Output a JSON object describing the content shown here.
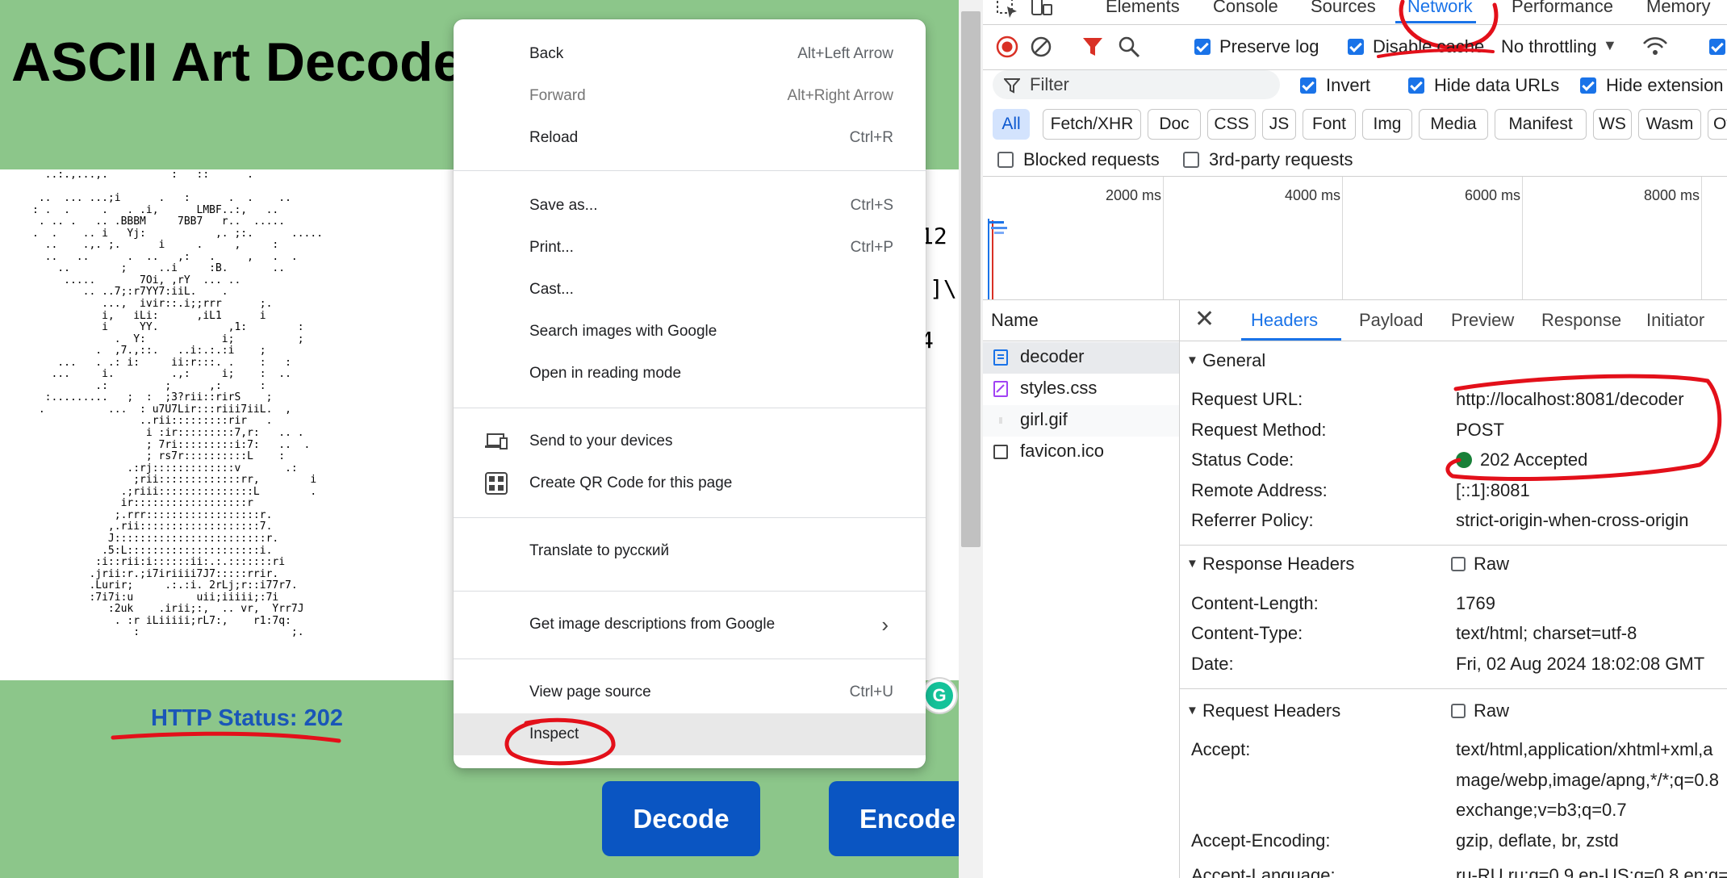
{
  "page": {
    "title": "ASCII Art Decoder",
    "http_status": "HTTP Status: 202",
    "side_fragments": [
      "12",
      "]\\",
      "4"
    ],
    "decode_label": "Decode",
    "encode_label": "Encode",
    "grammarly": "G",
    "ascii_art": "  ..:.,...,.          :   ::      .\n\n ..  ... ...;i      .   :      .  .    ..\n: .  .     .   . .i,      LMBF..:,   ..\n . .. .   .. .BBBM     7BB7   r..  .....\n.  .    .. i   Yj:           ,. ;:.      .....\n  ..    .,. ;.      i     .     ,     :\n  ..   ..      .  ..   ,:   .     ,   .  .\n    ..        ;     ..i     :B.       ..\n     .....       7Oi, ,rY  ... ..\n        .. ..7;:r7YY7:iiL.    .\n           ...,  ivir::.i;;rrr      ;.\n           i,   iLi:      ,iL1      i\n           i     YY.           ,1:        :\n             .  Y:            i;          ;\n          .  ,7.,::.   ..i:.:.:i    ;\n    ...   . .: i:     ii:r:::. .    :   :\n   ...     i.         .,:     i;    :  ..\n          .:         ;      ,:      :\n  :.........   ;  :  ;3?rii::rirS    ;\n .          ...  : u7U7Lir:::riii7iiL.  ,\n                 ..rii:::::::::rir   .\n                  i :ir:::::::::7,r:   .. .\n                  ; 7ri:::::::::i:7:   ..  .\n                  ; rs7r::::::::::L    :\n               .:rj:::::::::::::v       .:\n                ;rii:::::::::::::rr,        i\n              .;riii:::::::::::::::L        .\n              ir::::::::::::::::::r\n             ;.rrr::::::::::::::::::r.\n            ,.rii:::::::::::::::::::7.\n            J::::::::::::::::::::::::r.\n           .5:L:::::::::::::::::::::i.\n          :i::rii:i::::::ii:.:.:::::::ri\n         .jrii:r.;i7iriiii7J7:::::rrir.\n         .Lurir;     .:.:i. 2rLj;r::i77r7.\n         :7i7i:u          uii;iiiii;:7i\n            :2uk    .irii;:,  .. vr,  Yrr7J\n             . :r iLiiiii;rL7:,    r1:7q:\n                :                        ;."
  },
  "context_menu": {
    "items": [
      {
        "label": "Back",
        "shortcut": "Alt+Left Arrow"
      },
      {
        "label": "Forward",
        "shortcut": "Alt+Right Arrow"
      },
      {
        "label": "Reload",
        "shortcut": "Ctrl+R"
      },
      {
        "label": "Save as...",
        "shortcut": "Ctrl+S"
      },
      {
        "label": "Print...",
        "shortcut": "Ctrl+P"
      },
      {
        "label": "Cast...",
        "shortcut": ""
      },
      {
        "label": "Search images with Google",
        "shortcut": ""
      },
      {
        "label": "Open in reading mode",
        "shortcut": ""
      },
      {
        "label": "Send to your devices",
        "shortcut": ""
      },
      {
        "label": "Create QR Code for this page",
        "shortcut": ""
      },
      {
        "label": "Translate to русский",
        "shortcut": ""
      },
      {
        "label": "Get image descriptions from Google",
        "shortcut": ""
      },
      {
        "label": "View page source",
        "shortcut": "Ctrl+U"
      },
      {
        "label": "Inspect",
        "shortcut": ""
      }
    ]
  },
  "devtools": {
    "tabs": [
      "Elements",
      "Console",
      "Sources",
      "Network",
      "Performance",
      "Memory"
    ],
    "toolbar": {
      "preserve_log": "Preserve log",
      "disable_cache": "Disable cache",
      "throttling": "No throttling"
    },
    "filter": {
      "placeholder": "Filter",
      "invert": "Invert",
      "hide_data_urls": "Hide data URLs",
      "hide_extension": "Hide extension"
    },
    "types": [
      "All",
      "Fetch/XHR",
      "Doc",
      "CSS",
      "JS",
      "Font",
      "Img",
      "Media",
      "Manifest",
      "WS",
      "Wasm",
      "Othe"
    ],
    "blocked_requests": "Blocked requests",
    "third_party": "3rd-party requests",
    "timeline_labels": [
      "2000 ms",
      "4000 ms",
      "6000 ms",
      "8000 ms"
    ],
    "name_header": "Name",
    "requests": [
      "decoder",
      "styles.css",
      "girl.gif",
      "favicon.ico"
    ],
    "detail_tabs": [
      "Headers",
      "Payload",
      "Preview",
      "Response",
      "Initiator"
    ],
    "general": {
      "title": "General",
      "rows": [
        {
          "k": "Request URL:",
          "v": "http://localhost:8081/decoder"
        },
        {
          "k": "Request Method:",
          "v": "POST"
        },
        {
          "k": "Status Code:",
          "v": "202 Accepted"
        },
        {
          "k": "Remote Address:",
          "v": "[::1]:8081"
        },
        {
          "k": "Referrer Policy:",
          "v": "strict-origin-when-cross-origin"
        }
      ]
    },
    "response_headers": {
      "title": "Response Headers",
      "raw": "Raw",
      "rows": [
        {
          "k": "Content-Length:",
          "v": "1769"
        },
        {
          "k": "Content-Type:",
          "v": "text/html; charset=utf-8"
        },
        {
          "k": "Date:",
          "v": "Fri, 02 Aug 2024 18:02:08 GMT"
        }
      ]
    },
    "request_headers": {
      "title": "Request Headers",
      "raw": "Raw",
      "rows": [
        {
          "k": "Accept:",
          "v": "text/html,application/xhtml+xml,a"
        },
        {
          "k": "",
          "v": "mage/webp,image/apng,*/*;q=0.8"
        },
        {
          "k": "",
          "v": "exchange;v=b3;q=0.7"
        },
        {
          "k": "Accept-Encoding:",
          "v": "gzip, deflate, br, zstd"
        },
        {
          "k": "Accept-Language:",
          "v": "ru-RU,ru;q=0.9,en-US;q=0.8,en;q="
        }
      ]
    }
  },
  "colors": {
    "page_bg": "#8cc68a",
    "button_blue": "#0a55c2",
    "status_text": "#1a56b8",
    "annotation_red": "#e3101a",
    "devtools_accent": "#1a73e8"
  }
}
